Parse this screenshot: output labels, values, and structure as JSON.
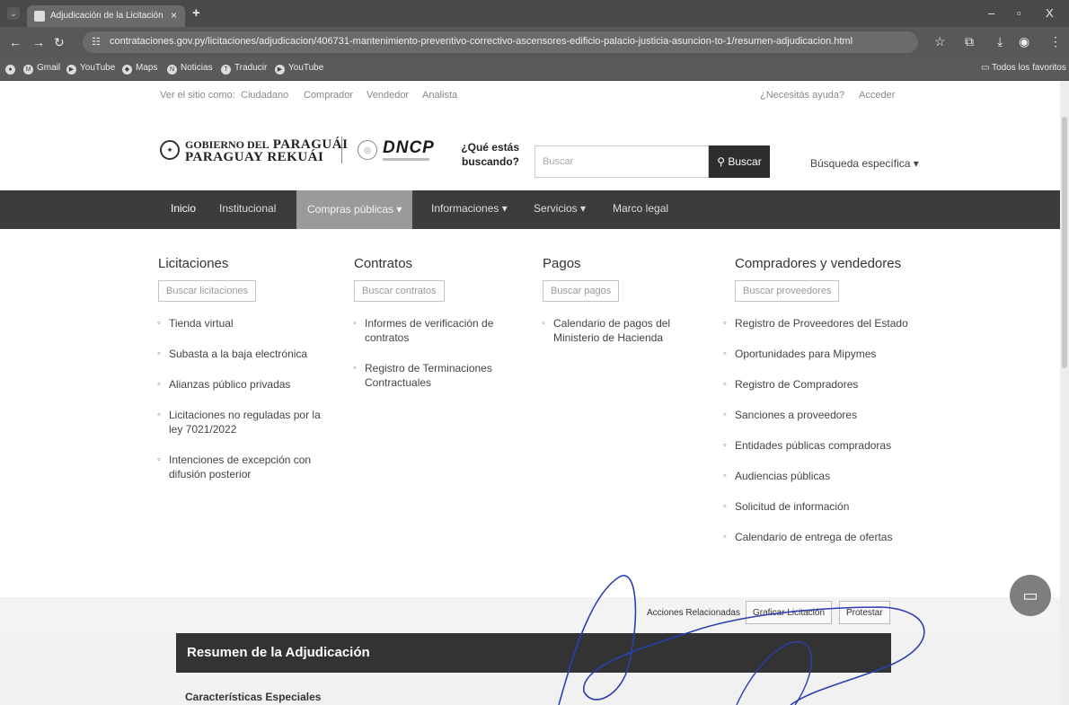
{
  "browser": {
    "tab_title": "Adjudicación de la Licitación 4(",
    "tab_close": "×",
    "new_tab": "+",
    "url": "contrataciones.gov.py/licitaciones/adjudicacion/406731-mantenimiento-preventivo-correctivo-ascensores-edificio-palacio-justicia-asuncion-to-1/resumen-adjudicacion.html",
    "window_controls": {
      "minimize": "–",
      "restore": "▫",
      "close": "X"
    },
    "bookmarks": [
      {
        "label": "Gmail",
        "icon": "M"
      },
      {
        "label": "YouTube",
        "icon": "▶"
      },
      {
        "label": "Maps",
        "icon": "◆"
      },
      {
        "label": "Noticias",
        "icon": "N"
      },
      {
        "label": "Traducir",
        "icon": "T"
      },
      {
        "label": "YouTube",
        "icon": "▶"
      }
    ],
    "all_bookmarks": "Todos los favoritos"
  },
  "utility_bar": {
    "view_as": "Ver el sitio como:",
    "roles": [
      "Ciudadano",
      "Comprador",
      "Vendedor",
      "Analista"
    ],
    "help": "¿Necesitás ayuda?",
    "login": "Acceder"
  },
  "brand": {
    "gov_line1_small": "GOBIERNO DEL",
    "gov_line1_big": "PARAGUÁI",
    "gov_line2_big": "PARAGUAY",
    "gov_line2_right": "REKUÁI",
    "dncp": "DNCP"
  },
  "search": {
    "question": "¿Qué estás buscando?",
    "placeholder": "Buscar",
    "button": "Buscar",
    "advanced": "Búsqueda específica ▾"
  },
  "nav": {
    "items": [
      "Inicio",
      "Institucional",
      "Compras públicas ▾",
      "Informaciones ▾",
      "Servicios ▾",
      "Marco legal"
    ]
  },
  "mega_menu": {
    "columns": [
      {
        "title": "Licitaciones",
        "search": "Buscar licitaciones",
        "items": [
          "Tienda virtual",
          "Subasta a la baja electrónica",
          "Alianzas público privadas",
          "Licitaciones no reguladas por la ley 7021/2022",
          "Intenciones de excepción con difusión posterior"
        ]
      },
      {
        "title": "Contratos",
        "search": "Buscar contratos",
        "items": [
          "Informes de verificación de contratos",
          "Registro de Terminaciones Contractuales"
        ]
      },
      {
        "title": "Pagos",
        "search": "Buscar pagos",
        "items": [
          "Calendario de pagos del Ministerio de Hacienda"
        ]
      },
      {
        "title": "Compradores y vendedores",
        "search": "Buscar proveedores",
        "items": [
          "Registro de Proveedores del Estado",
          "Oportunidades para Mipymes",
          "Registro de Compradores",
          "Sanciones a proveedores",
          "Entidades públicas compradoras",
          "Audiencias públicas",
          "Solicitud de información",
          "Calendario de entrega de ofertas"
        ]
      }
    ]
  },
  "related": {
    "label": "Acciones Relacionadas",
    "chart_button": "Graficar Licitación",
    "protest_button": "Protestar"
  },
  "content": {
    "summary_title": "Resumen de la Adjudicación",
    "special_title": "Características Especiales"
  }
}
